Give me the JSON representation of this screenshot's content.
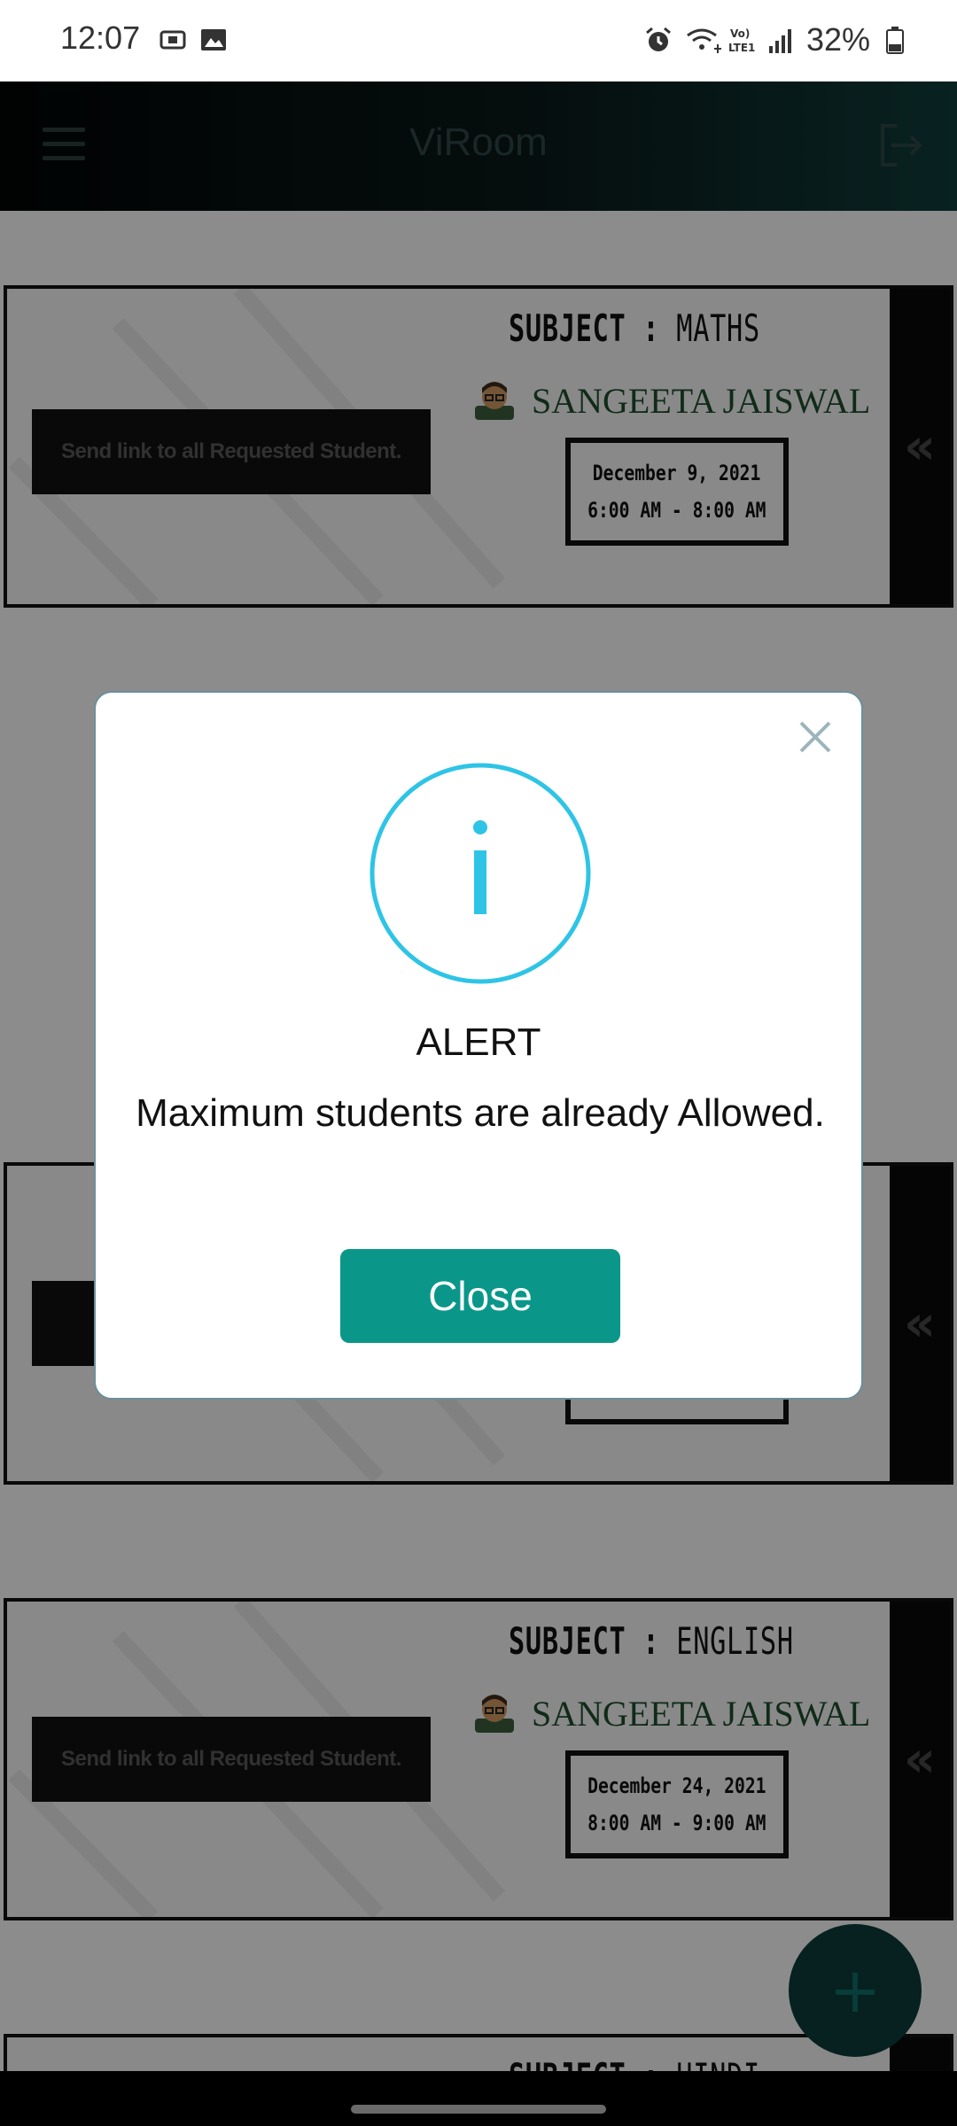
{
  "status_bar": {
    "time": "12:07",
    "battery": "32%",
    "icons": [
      "screenshot-icon",
      "gallery-icon",
      "alarm-icon",
      "wifi-icon",
      "volte-icon",
      "signal-icon",
      "battery-icon"
    ]
  },
  "header": {
    "title": "ViRoom",
    "menu_icon": "hamburger-menu-icon",
    "logout_icon": "logout-icon"
  },
  "cards": [
    {
      "send_label": "Send link to all Requested Student.",
      "subject_label": "SUBJECT :",
      "subject": "MATHS",
      "teacher": "SANGEETA JAISWAL",
      "date": "December 9, 2021",
      "time": "6:00 AM - 8:00 AM"
    },
    {
      "send_label": "Send link to all Requested Student.",
      "subject_label": "SUBJECT :",
      "subject": "ENGLISH",
      "teacher": "SANGEETA JAISWAL",
      "date": "December 24, 2021",
      "time": "8:00 AM - 9:00 AM"
    },
    {
      "subject_label": "SUBJECT :",
      "subject": "HINDI"
    }
  ],
  "dialog": {
    "title": "ALERT",
    "message": "Maximum students are already Allowed.",
    "close_label": "Close",
    "accent_color": "#2ec4e6",
    "button_color": "#0a978a"
  },
  "fab_icon": "plus-icon"
}
